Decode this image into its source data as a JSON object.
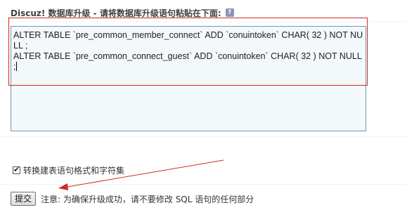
{
  "header": {
    "title": "Discuz! 数据库升级 - 请将数据库升级语句粘贴在下面:",
    "help_icon": "?"
  },
  "sql_input": {
    "value": "ALTER TABLE `pre_common_member_connect` ADD `conuintoken` CHAR( 32 ) NOT NULL ;\nALTER TABLE `pre_common_connect_guest` ADD `conuintoken` CHAR( 32 ) NOT NULL ;"
  },
  "options": {
    "convert_format_label": "转换建表语句格式和字符集",
    "convert_format_checked": true
  },
  "form": {
    "submit_label": "提交",
    "note": "注意: 为确保升级成功，请不要修改 SQL 语句的任何部分"
  },
  "annotations": {
    "highlight_color": "#d12a2a"
  }
}
